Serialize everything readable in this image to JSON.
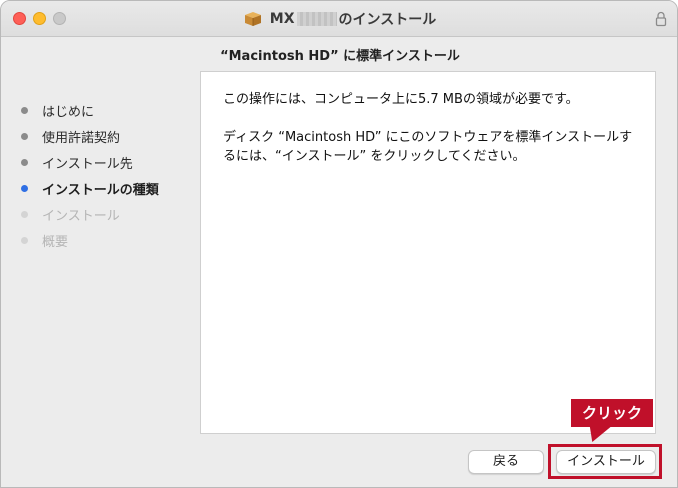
{
  "window": {
    "title_prefix": "MX",
    "title_suffix": "のインストール"
  },
  "subheading": "“Macintosh HD” に標準インストール",
  "sidebar": {
    "steps": [
      {
        "label": "はじめに",
        "state": "done"
      },
      {
        "label": "使用許諾契約",
        "state": "done"
      },
      {
        "label": "インストール先",
        "state": "done"
      },
      {
        "label": "インストールの種類",
        "state": "current"
      },
      {
        "label": "インストール",
        "state": "pending"
      },
      {
        "label": "概要",
        "state": "pending"
      }
    ]
  },
  "content": {
    "line1": "この操作には、コンピュータ上に5.7 MBの領域が必要です。",
    "line2": "ディスク “Macintosh HD” にこのソフトウェアを標準インストールするには、“インストール” をクリックしてください。"
  },
  "buttons": {
    "back_label": "戻る",
    "install_label": "インストール"
  },
  "annotation": {
    "callout_label": "クリック",
    "color": "#c0102a"
  },
  "icons": {
    "app": "package-icon",
    "lock": "lock-icon"
  }
}
